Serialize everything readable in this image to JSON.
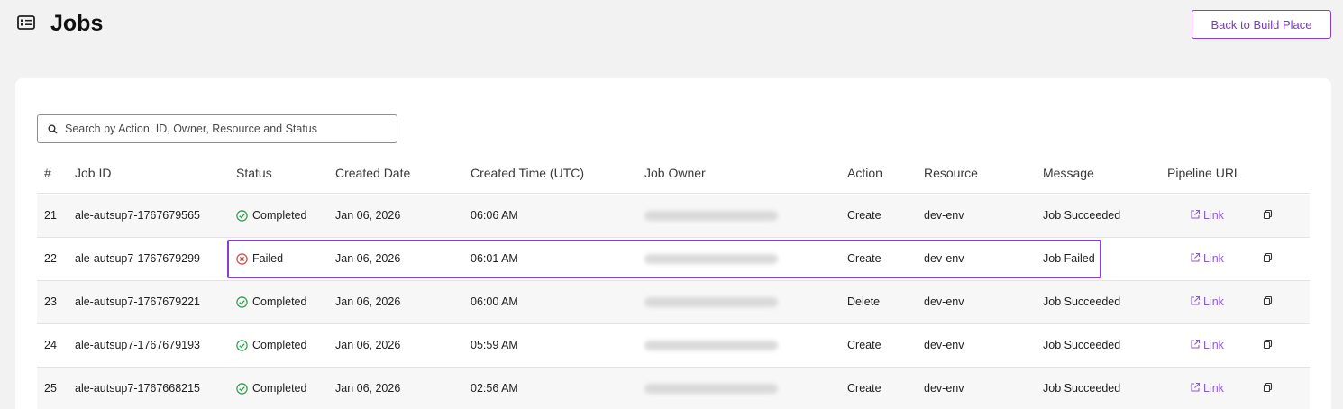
{
  "header": {
    "title": "Jobs",
    "icon": "jobs-list-icon",
    "back_button_label": "Back to Build Place"
  },
  "search": {
    "placeholder": "Search by Action, ID, Owner, Resource and Status",
    "value": ""
  },
  "table": {
    "columns": [
      "#",
      "Job ID",
      "Status",
      "Created Date",
      "Created Time (UTC)",
      "Job Owner",
      "Action",
      "Resource",
      "Message",
      "Pipeline URL"
    ],
    "rows": [
      {
        "num": "21",
        "job_id": "ale-autsup7-1767679565",
        "status": "Completed",
        "status_kind": "success",
        "date": "Jan 06, 2026",
        "time": "06:06 AM",
        "action": "Create",
        "resource": "dev-env",
        "message": "Job Succeeded",
        "link": "Link"
      },
      {
        "num": "22",
        "job_id": "ale-autsup7-1767679299",
        "status": "Failed",
        "status_kind": "failed",
        "date": "Jan 06, 2026",
        "time": "06:01 AM",
        "action": "Create",
        "resource": "dev-env",
        "message": "Job Failed",
        "link": "Link"
      },
      {
        "num": "23",
        "job_id": "ale-autsup7-1767679221",
        "status": "Completed",
        "status_kind": "success",
        "date": "Jan 06, 2026",
        "time": "06:00 AM",
        "action": "Delete",
        "resource": "dev-env",
        "message": "Job Succeeded",
        "link": "Link"
      },
      {
        "num": "24",
        "job_id": "ale-autsup7-1767679193",
        "status": "Completed",
        "status_kind": "success",
        "date": "Jan 06, 2026",
        "time": "05:59 AM",
        "action": "Create",
        "resource": "dev-env",
        "message": "Job Succeeded",
        "link": "Link"
      },
      {
        "num": "25",
        "job_id": "ale-autsup7-1767668215",
        "status": "Completed",
        "status_kind": "success",
        "date": "Jan 06, 2026",
        "time": "02:56 AM",
        "action": "Create",
        "resource": "dev-env",
        "message": "Job Succeeded",
        "link": "Link"
      }
    ]
  },
  "colors": {
    "accent": "#8a3fd1",
    "link": "#8c5ad6",
    "success": "#2e9d4a",
    "failed": "#d64545"
  }
}
